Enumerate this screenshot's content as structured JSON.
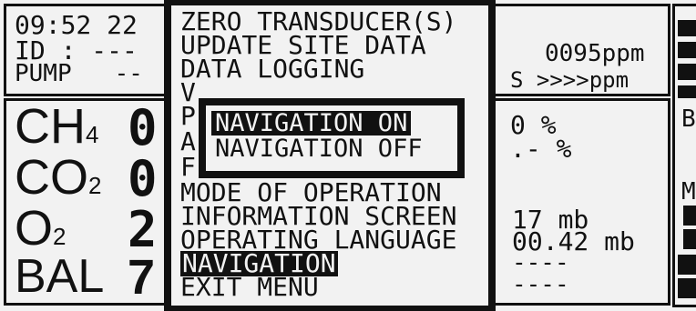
{
  "status": {
    "time": "09:52 22",
    "id": "ID : ---",
    "pump": "PUMP   --",
    "reading_top": "0095ppm",
    "reading_second": "S >>>>ppm"
  },
  "gases": [
    {
      "label": "CH",
      "sub": "4",
      "value": "0"
    },
    {
      "label": "CO",
      "sub": "2",
      "value": "0"
    },
    {
      "label": "O",
      "sub": "2",
      "value": "2"
    },
    {
      "label": "BAL",
      "sub": "",
      "value": "7"
    }
  ],
  "right_readings": {
    "r1": "0 %",
    "r2": ".- %",
    "r3": "17 mb",
    "r4": "00.42 mb",
    "r5": "----",
    "r6": "----"
  },
  "right_edge": {
    "e1": "B",
    "e2": "M"
  },
  "menu": {
    "items": [
      "ZERO TRANSDUCER(S)",
      "UPDATE SITE DATA",
      "DATA LOGGING",
      "V",
      "P",
      "A",
      "F",
      "MODE OF OPERATION",
      "INFORMATION SCREEN",
      "OPERATING LANGUAGE",
      "NAVIGATION",
      "EXIT MENU"
    ],
    "selected_index": 10
  },
  "submenu": {
    "options": [
      "NAVIGATION ON",
      "NAVIGATION OFF"
    ],
    "selected_index": 0
  }
}
